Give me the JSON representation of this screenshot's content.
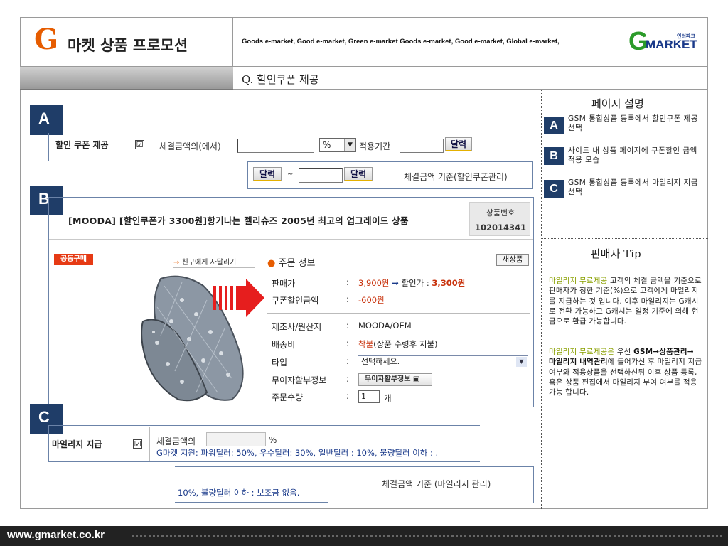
{
  "header": {
    "logo_g": "G",
    "title": "마켓 상품 프로모션",
    "tagline": "Goods e-market, Good e-market, Green e-market Goods e-market, Good e-market, Global e-market,",
    "brand_g": "G",
    "brand_market": "MARKET",
    "brand_small": "인터파크",
    "question": "Q. 할인쿠폰 제공"
  },
  "right_panel": {
    "page_desc_title": "페이지 설명",
    "items": [
      {
        "badge": "A",
        "text": "GSM 통합상품 등록에서 할인쿠폰 제공 선택"
      },
      {
        "badge": "B",
        "text": "사이트 내 상품 페이지에 쿠폰할인 금액 적용 모습"
      },
      {
        "badge": "C",
        "text": "GSM 통합상품 등록에서 마일리지 지급 선택"
      }
    ],
    "seller_tip_title": "판매자 Tip",
    "tip1_highlight": "마일리지 무료제공",
    "tip1_text": " 고객의 체결 금액을 기준으로 판매자가 정한 기준(%)으로 고객에게 마일리지를 지급하는 것 입니다. 이후 마일리지는 G캐시로 전환 가능하고 G캐시는 일정 기준에 의해 현금으로 환급 가능합니다.",
    "tip2_highlight": "마일리지 무료제공은",
    "tip2_mid": " 우선 ",
    "tip2_bold": "GSM→상품관리→ 마일리지 내역관리",
    "tip2_text": "에 들어가신 후 마일리지 지급여부와 적용상품을 선택하신뒤 이후 상품 등록, 혹은 상품 편집에서 마일리지 부여 여부를 적용 가능 합니다."
  },
  "section_a": {
    "badge": "A",
    "label": "할인 쿠폰 제공",
    "check": "☑",
    "amount_label": "체결금액의(에서)",
    "unit": "%",
    "period_label": "적용기간",
    "calendar_btn": "달력",
    "calendar_btn2": "달력",
    "calendar_btn3": "달력",
    "tilde": "~",
    "basis": "체결금액 기준(할인쿠폰관리)"
  },
  "section_b": {
    "badge": "B",
    "product_title": "[MOODA] [할인쿠폰가 3300원]향기나는 젤리슈즈 2005년 최고의 업그레이드 상품",
    "product_no_label": "상품번호",
    "product_no": "102014341",
    "group_buy": "공동구매",
    "friend_link_arrow": "→",
    "friend_link": "친구에게 사달리기",
    "order_info_dot": "●",
    "order_info": "주문 정보",
    "new_btn": "새상품",
    "rows": {
      "price_label": "판매가",
      "price": "3,900원",
      "price_arrow": "→",
      "discount_label": "할인가 :",
      "discount_price": "3,300원",
      "coupon_label": "쿠폰할인금액",
      "coupon_value": "-600원",
      "maker_label": "제조사/원산지",
      "maker_value": "MOODA/OEM",
      "ship_label": "배송비",
      "ship_value_a": "착불",
      "ship_value_b": "(상품 수령후 지불)",
      "type_label": "타입",
      "type_select": "선택하세요.",
      "installment_label": "무이자할부정보",
      "installment_btn": "무이자할부정보",
      "qty_label": "주문수량",
      "qty_value": "1",
      "qty_unit": "개",
      "colon": ":"
    }
  },
  "section_c": {
    "badge": "C",
    "label": "마일리지 지급",
    "check": "☑",
    "amount_label": "체결금액의",
    "unit": "%",
    "support": "G마켓 지원: 파워딜러: 50%, 우수딜러: 30%, 일반딜러 : 10%, 불량딜러 이하 : .",
    "support2": "10%, 불량딜러 이하 : 보조금 없음.",
    "basis": "체결금액 기준 (마일리지 관리)"
  },
  "footer": {
    "url": "www.gmarket.co.kr"
  }
}
